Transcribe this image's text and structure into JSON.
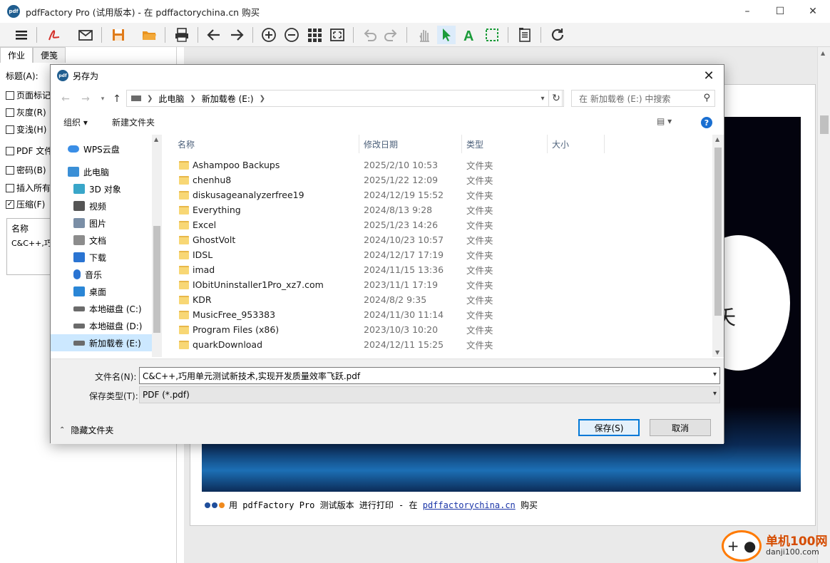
{
  "window": {
    "title": "pdfFactory Pro (试用版本) - 在 pdffactorychina.cn 购买",
    "app_icon_text": "pdf"
  },
  "left_panel": {
    "tabs": [
      "作业",
      "便笺"
    ],
    "title_label": "标题(A):",
    "options": [
      {
        "label": "页面标记",
        "checked": false
      },
      {
        "label": "灰度(R)",
        "checked": false
      },
      {
        "label": "变浅(H)",
        "checked": false
      },
      {
        "label": "PDF 文件",
        "checked": false
      },
      {
        "label": "密码(B)",
        "checked": false
      },
      {
        "label": "插入所有",
        "checked": false
      },
      {
        "label": "压缩(F)",
        "checked": true
      }
    ],
    "name_header": "名称",
    "name_value": "C&C++,巧用"
  },
  "preview": {
    "partial_char": "夭",
    "footer": {
      "prefix": "用 pdfFactory Pro 测试版本 进行打印 - 在 ",
      "link": "pdffactorychina.cn",
      "suffix": " 购买"
    }
  },
  "dialog": {
    "title": "另存为",
    "icon_text": "pdf",
    "address": {
      "segments": [
        "此电脑",
        "新加载卷 (E:)"
      ]
    },
    "search_placeholder": "在 新加载卷 (E:) 中搜索",
    "commands": {
      "organize": "组织 ▾",
      "new_folder": "新建文件夹",
      "help": "?"
    },
    "nav_items": [
      {
        "label": "WPS云盘",
        "icon": "cloud-icon",
        "color": "#3a8ee6"
      },
      {
        "label": "此电脑",
        "icon": "computer-icon",
        "color": "#3b8fd6"
      },
      {
        "label": "3D 对象",
        "icon": "cube-icon",
        "color": "#39a6c9"
      },
      {
        "label": "视频",
        "icon": "video-icon",
        "color": "#555555"
      },
      {
        "label": "图片",
        "icon": "picture-icon",
        "color": "#7a8ea6"
      },
      {
        "label": "文档",
        "icon": "document-icon",
        "color": "#8c8c8c"
      },
      {
        "label": "下载",
        "icon": "download-icon",
        "color": "#2a74d2"
      },
      {
        "label": "音乐",
        "icon": "music-icon",
        "color": "#2a74d2"
      },
      {
        "label": "桌面",
        "icon": "desktop-icon",
        "color": "#2a86d6"
      },
      {
        "label": "本地磁盘 (C:)",
        "icon": "drive-icon",
        "color": "#6b6b6b"
      },
      {
        "label": "本地磁盘 (D:)",
        "icon": "drive-icon",
        "color": "#6b6b6b"
      },
      {
        "label": "新加载卷 (E:)",
        "icon": "drive-icon",
        "color": "#6b6b6b",
        "selected": true
      }
    ],
    "columns": [
      "名称",
      "修改日期",
      "类型",
      "大小"
    ],
    "files": [
      {
        "name": "Ashampoo Backups",
        "date": "2025/2/10 10:53",
        "type": "文件夹"
      },
      {
        "name": "chenhu8",
        "date": "2025/1/22 12:09",
        "type": "文件夹"
      },
      {
        "name": "diskusageanalyzerfree19",
        "date": "2024/12/19 15:52",
        "type": "文件夹"
      },
      {
        "name": "Everything",
        "date": "2024/8/13 9:28",
        "type": "文件夹"
      },
      {
        "name": "Excel",
        "date": "2025/1/23 14:26",
        "type": "文件夹"
      },
      {
        "name": "GhostVolt",
        "date": "2024/10/23 10:57",
        "type": "文件夹"
      },
      {
        "name": "IDSL",
        "date": "2024/12/17 17:19",
        "type": "文件夹"
      },
      {
        "name": "imad",
        "date": "2024/11/15 13:36",
        "type": "文件夹"
      },
      {
        "name": "IObitUninstaller1Pro_xz7.com",
        "date": "2023/11/1 17:19",
        "type": "文件夹"
      },
      {
        "name": "KDR",
        "date": "2024/8/2 9:35",
        "type": "文件夹"
      },
      {
        "name": "MusicFree_953383",
        "date": "2024/11/30 11:14",
        "type": "文件夹"
      },
      {
        "name": "Program Files (x86)",
        "date": "2023/10/3 10:20",
        "type": "文件夹"
      },
      {
        "name": "quarkDownload",
        "date": "2024/12/11 15:25",
        "type": "文件夹"
      }
    ],
    "filename_label": "文件名(N):",
    "filename_value": "C&C++,巧用单元测试新技术,实现开发质量效率飞跃.pdf",
    "filetype_label": "保存类型(T):",
    "filetype_value": "PDF (*.pdf)",
    "save_button": "保存(S)",
    "cancel_button": "取消",
    "hide_folders": "隐藏文件夹"
  },
  "watermark": {
    "line1": "单机100网",
    "line2": "danji100.com"
  },
  "colors": {
    "accent": "#0078d7",
    "pdf_red": "#d4302a",
    "save_orange": "#e07b1a",
    "green_cursor": "#1b9b3a"
  }
}
